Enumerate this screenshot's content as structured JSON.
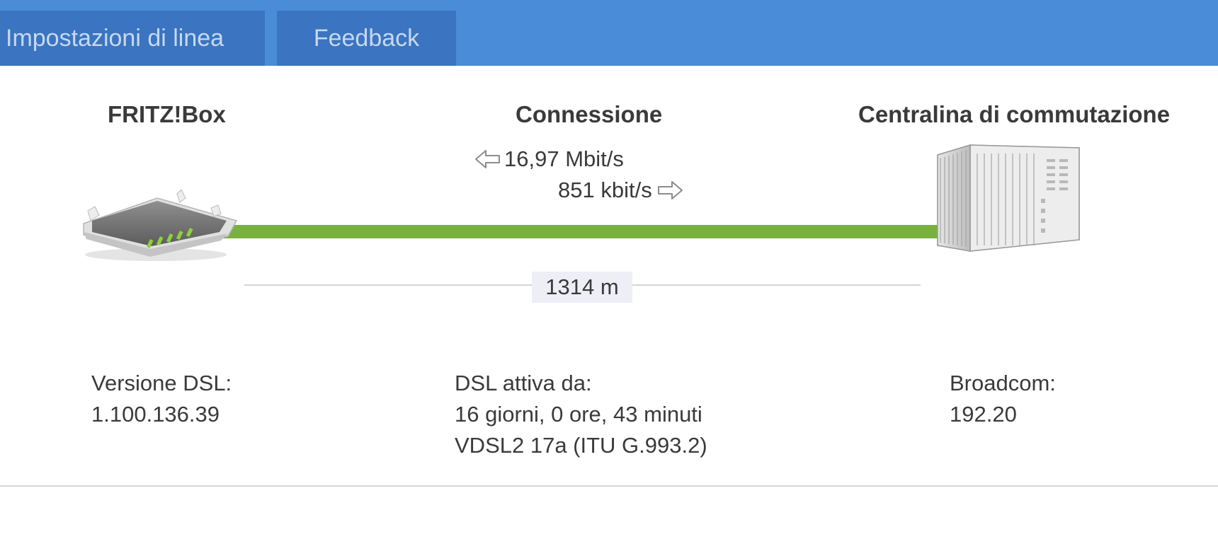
{
  "tabs": [
    {
      "label": "Impostazioni di linea"
    },
    {
      "label": "Feedback"
    }
  ],
  "columns": {
    "left_title": "FRITZ!Box",
    "center_title": "Connessione",
    "right_title": "Centralina di commutazione"
  },
  "rates": {
    "downstream": "16,97 Mbit/s",
    "upstream": "851 kbit/s"
  },
  "distance": "1314 m",
  "left_info": {
    "label": "Versione DSL:",
    "value": "1.100.136.39"
  },
  "center_info": {
    "label": "DSL attiva da:",
    "uptime": "16 giorni, 0 ore, 43 minuti",
    "standard": "VDSL2 17a (ITU G.993.2)"
  },
  "right_info": {
    "label": "Broadcom:",
    "value": "192.20"
  },
  "colors": {
    "header_bg": "#4a8cd8",
    "tab_bg": "#3b74c0",
    "line_green": "#78b13f",
    "led_green": "#8fd13a"
  },
  "icons": [
    "arrow-left-icon",
    "arrow-right-icon",
    "router-icon",
    "exchange-icon"
  ]
}
